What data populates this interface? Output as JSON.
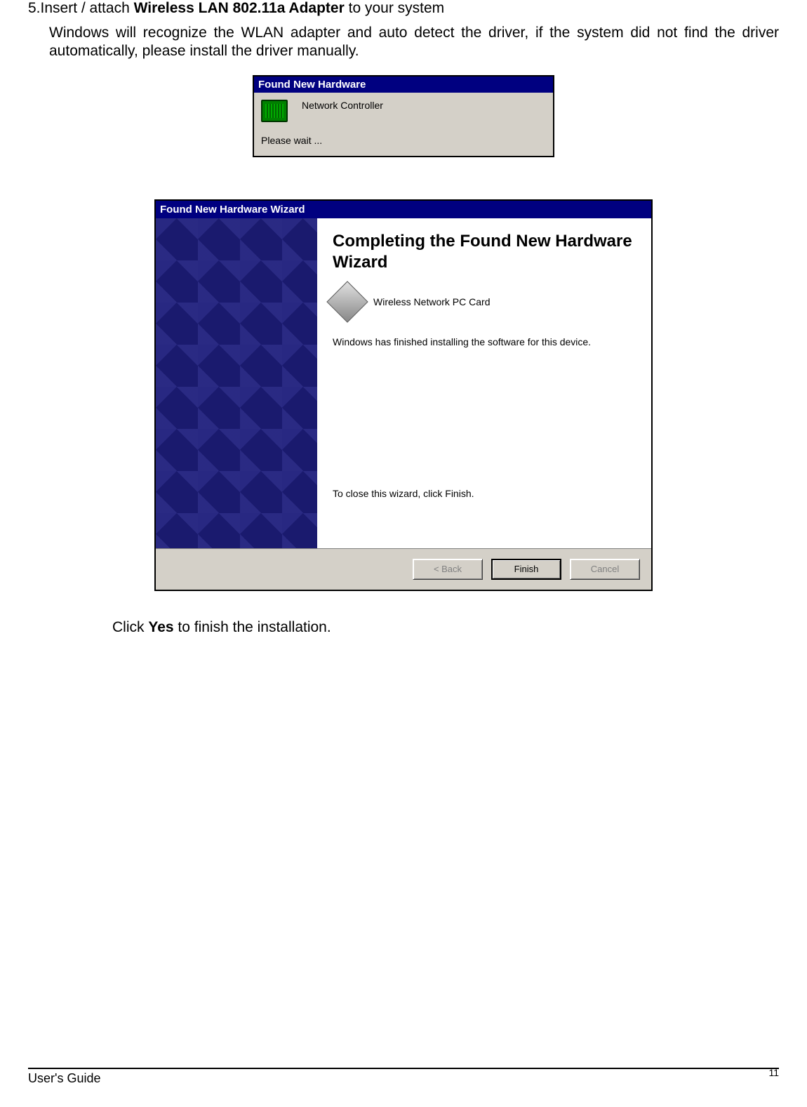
{
  "step": {
    "number": "5.",
    "prefix": "Insert / attach ",
    "bold": "Wireless LAN 802.11a Adapter",
    "suffix": " to your system"
  },
  "body_text": "Windows will recognize the WLAN adapter and auto detect the driver, if the system did not find the driver automatically, please install the driver manually.",
  "dlg1": {
    "title": "Found New Hardware",
    "device": "Network Controller",
    "wait": "Please wait ..."
  },
  "dlg2": {
    "title": "Found New Hardware Wizard",
    "heading": "Completing the Found New Hardware Wizard",
    "device": "Wireless Network PC Card",
    "installed": "Windows has finished installing the software for this device.",
    "close": "To close this wizard, click Finish.",
    "buttons": {
      "back": "< Back",
      "finish": "Finish",
      "cancel": "Cancel"
    }
  },
  "post": {
    "prefix": "Click ",
    "bold": "Yes",
    "suffix": " to finish the installation."
  },
  "footer": {
    "left": "User's Guide",
    "right": "11"
  }
}
